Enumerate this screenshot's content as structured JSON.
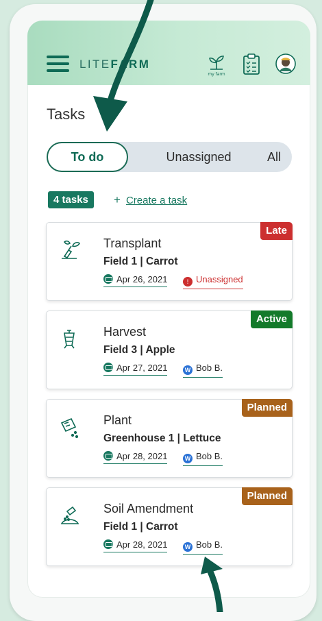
{
  "header": {
    "logo_light": "LITE",
    "logo_bold": "FARM",
    "farm_icon_caption": "my farm"
  },
  "page": {
    "title": "Tasks"
  },
  "tabs": [
    {
      "label": "To do",
      "active": true
    },
    {
      "label": "Unassigned",
      "active": false
    },
    {
      "label": "All",
      "active": false
    }
  ],
  "summary": {
    "count_label": "4 tasks",
    "create_plus": "+",
    "create_label": "Create a task"
  },
  "tasks": [
    {
      "name": "Transplant",
      "location": "Field 1  |  Carrot",
      "date": "Apr 26, 2021",
      "assignee": "Unassigned",
      "assignee_initial": "",
      "status": "Late",
      "status_color": "#cc2f2f",
      "icon": "transplant-icon"
    },
    {
      "name": "Harvest",
      "location": "Field 3  |  Apple",
      "date": "Apr 27, 2021",
      "assignee": "Bob B.",
      "assignee_initial": "W",
      "status": "Active",
      "status_color": "#137a2a",
      "icon": "harvest-icon"
    },
    {
      "name": "Plant",
      "location": "Greenhouse 1  |  Lettuce",
      "date": "Apr 28, 2021",
      "assignee": "Bob B.",
      "assignee_initial": "W",
      "status": "Planned",
      "status_color": "#a8621b",
      "icon": "plant-seed-icon"
    },
    {
      "name": "Soil Amendment",
      "location": "Field 1 |  Carrot",
      "date": "Apr 28, 2021",
      "assignee": "Bob B.",
      "assignee_initial": "W",
      "status": "Planned",
      "status_color": "#a8621b",
      "icon": "soil-amendment-icon"
    }
  ],
  "colors": {
    "brand_green": "#187860",
    "arrow_green": "#0e5a4a"
  }
}
